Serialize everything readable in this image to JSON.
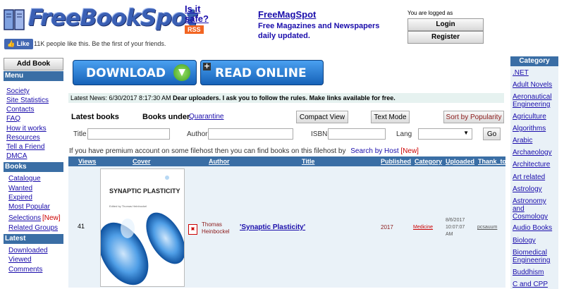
{
  "header": {
    "logo_text": "FreeBookSpot",
    "is_safe": "Is it safe?",
    "rss": "RSS",
    "fb_like": "Like",
    "fb_text": "11K people like this. Be the first of your friends.",
    "mag_title": "FreeMagSpot",
    "mag_desc": "Free Magazines and Newspapers daily updated.",
    "logged_text": "You are logged as",
    "login": "Login",
    "register": "Register"
  },
  "sidebar": {
    "add_book": "Add Book",
    "menu_head": "Menu",
    "menu": [
      "Society",
      "Site Statistics",
      "Contacts",
      "FAQ",
      "How it works",
      "Resources",
      "Tell a Friend",
      "DMCA"
    ],
    "books_head": "Books",
    "books": [
      "Catalogue",
      "Wanted",
      "Expired",
      "Most Popular",
      "Selections",
      "Related Groups"
    ],
    "new_tag": "[New]",
    "latest_head": "Latest",
    "latest": [
      "Downloaded",
      "Viewed",
      "Comments"
    ]
  },
  "main": {
    "download": "DOWNLOAD",
    "read_online": "READ ONLINE",
    "news_prefix": "Latest News: 6/30/2017 8:17:30 AM",
    "news_body": "Dear uploaders. I ask you to follow the rules. Make links available for free.",
    "latest_books": "Latest books",
    "books_under": "Books under",
    "quarantine": "Quarantine",
    "compact_view": "Compact View",
    "text_mode": "Text Mode",
    "sort_popularity": "Sort by Popularity",
    "search": {
      "title_label": "Title",
      "author_label": "Author",
      "isbn_label": "ISBN",
      "lang_label": "Lang",
      "go": "Go"
    },
    "premium_text": "If you have premium account on some filehost then you can find books on this filehost by",
    "search_by_host": "Search by Host",
    "new_tag": "[New]"
  },
  "table": {
    "headers": [
      "Views",
      "Cover",
      "Author",
      "Title",
      "Published",
      "Category",
      "Uploaded",
      "Thank_to"
    ],
    "row": {
      "views": "41",
      "cover_title": "SYNAPTIC PLASTICITY",
      "cover_sub": "Edited by Thomas Heinbockel",
      "author": "Thomas Heinbockel",
      "title": "'Synaptic Plasticity'",
      "published": "2017",
      "category": "Medicine",
      "uploaded": "8/6/2017 10:07:07 AM",
      "thank_to": "pcsauum"
    }
  },
  "categories": {
    "head": "Category",
    "items": [
      ".NET",
      "Adult Novels",
      "Aeronautical Engineering",
      "Agriculture",
      "Algorithms",
      "Arabic",
      "Archaeology",
      "Architecture",
      "Art related",
      "Astrology",
      "Astronomy and Cosmology",
      "Audio Books",
      "Biology",
      "Biomedical Engineering",
      "Buddhism",
      "C and CPP"
    ]
  },
  "colors": {
    "accent": "#3a6ea5",
    "link": "#1a0dab",
    "rss": "#f26522",
    "fb": "#4267b2"
  }
}
